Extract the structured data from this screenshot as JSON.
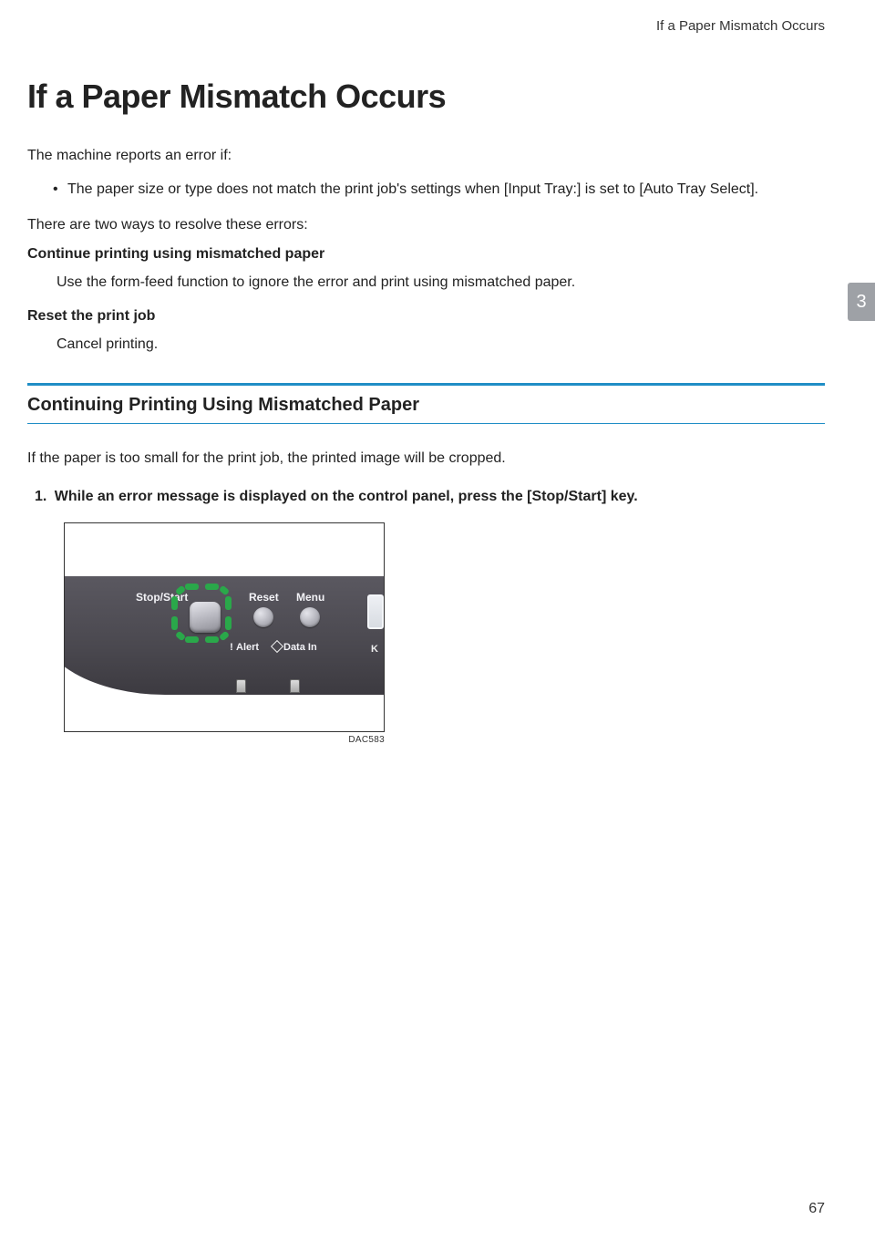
{
  "header": {
    "running_title": "If a Paper Mismatch Occurs"
  },
  "title": "If a Paper Mismatch Occurs",
  "intro": "The machine reports an error if:",
  "bullets": [
    "The paper size or type does not match the print job's settings when [Input Tray:] is set to [Auto Tray Select]."
  ],
  "resolve_intro": "There are two ways to resolve these errors:",
  "definitions": [
    {
      "term": "Continue printing using mismatched paper",
      "desc": "Use the form-feed function to ignore the error and print using mismatched paper."
    },
    {
      "term": "Reset the print job",
      "desc": "Cancel printing."
    }
  ],
  "section": {
    "heading": "Continuing Printing Using Mismatched Paper",
    "intro": "If the paper is too small for the print job, the printed image will be cropped.",
    "steps": [
      {
        "num": "1.",
        "text": "While an error message is displayed on the control panel, press the [Stop/Start] key."
      }
    ]
  },
  "figure": {
    "labels": {
      "stopstart": "Stop/Start",
      "reset": "Reset",
      "menu": "Menu",
      "alert": "Alert",
      "datain": "Data In",
      "k": "K"
    },
    "code": "DAC583"
  },
  "chapter_tab": "3",
  "page_number": "67"
}
